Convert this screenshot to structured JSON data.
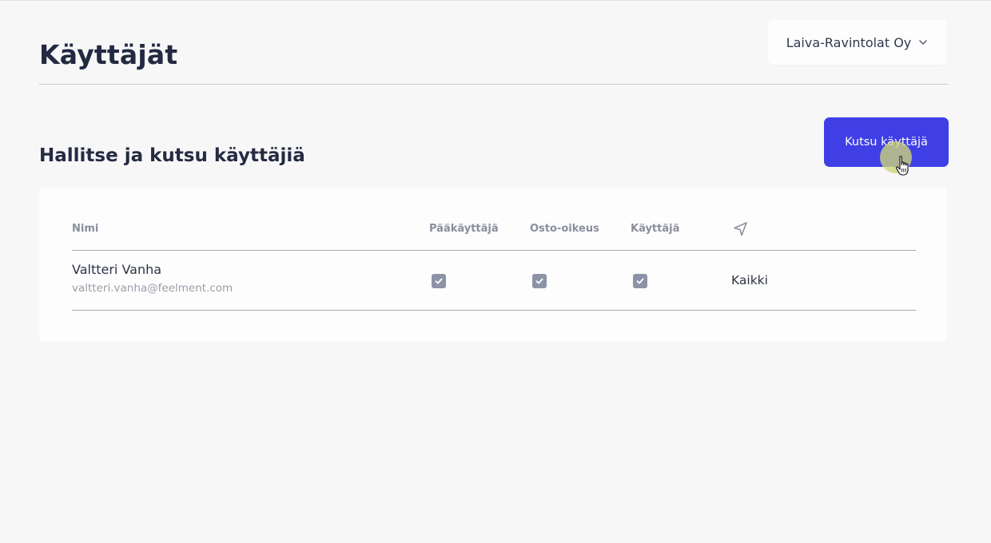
{
  "header": {
    "title": "Käyttäjät",
    "company_select": {
      "value": "Laiva-Ravintolat Oy",
      "icon": "chevron-down-icon"
    }
  },
  "section": {
    "title": "Hallitse ja kutsu käyttäjiä",
    "invite_button_label": "Kutsu käyttäjä"
  },
  "table": {
    "columns": {
      "name": "Nimi",
      "admin": "Pääkäyttäjä",
      "purchase": "Osto-oikeus",
      "user": "Käyttäjä",
      "scope_icon": "send-icon"
    },
    "rows": [
      {
        "name": "Valtteri Vanha",
        "email": "valtteri.vanha@feelment.com",
        "admin": true,
        "purchase": true,
        "user": true,
        "scope": "Kaikki"
      }
    ]
  },
  "colors": {
    "accent": "#3f3fe5",
    "checkbox": "#8c93a7",
    "title": "#222a41",
    "background": "#f7f7f8"
  }
}
